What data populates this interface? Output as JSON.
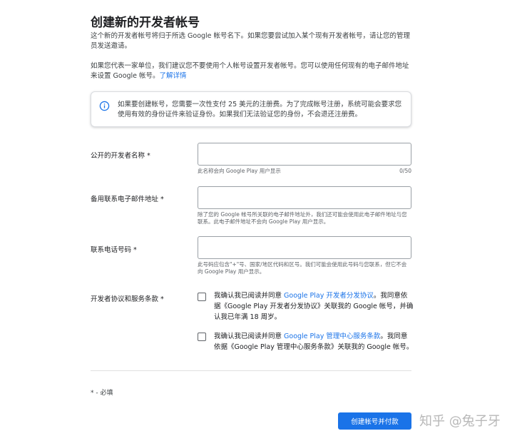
{
  "header": {
    "title": "创建新的开发者帐号"
  },
  "intro": {
    "paragraph1": "这个新的开发者帐号将归于所选 Google 帐号名下。如果您要尝试加入某个现有开发者帐号，请让您的管理员发送邀请。",
    "paragraph2": "如果您代表一家单位，我们建议您不要使用个人帐号设置开发者帐号。您可以使用任何现有的电子邮件地址来设置 Google 帐号。",
    "learn_more": "了解详情"
  },
  "info_card": {
    "icon": "info-icon",
    "text": "如果要创建帐号，您需要一次性支付 25 美元的注册费。为了完成帐号注册，系统可能会要求您使用有效的身份证件来验证身份。如果我们无法验证您的身份，不会退还注册费。"
  },
  "fields": {
    "developer_name": {
      "label": "公开的开发者名称 *",
      "value": "",
      "helper": "此名称会向 Google Play 用户显示",
      "counter": "0/50"
    },
    "backup_email": {
      "label": "备用联系电子邮件地址 *",
      "value": "",
      "helper": "除了您的 Google 帐号所关联的电子邮件地址外，我们还可能会使用此电子邮件地址与您联系。此电子邮件地址不会向 Google Play 用户显示。"
    },
    "phone": {
      "label": "联系电话号码 *",
      "value": "",
      "helper": "此号码应包含\"+\"号、国家/地区代码和区号。我们可能会使用此号码与您联系，但它不会向 Google Play 用户显示。"
    }
  },
  "agreements": {
    "label": "开发者协议和服务条款 *",
    "item1": {
      "checked": false,
      "prefix": "我确认我已阅读并同意 ",
      "link": "Google Play 开发者分发协议",
      "suffix": "。我同意依据《Google Play 开发者分发协议》关联我的 Google 帐号，并确认我已年满 18 周岁。"
    },
    "item2": {
      "checked": false,
      "prefix": "我确认我已阅读并同意 ",
      "link": "Google Play 管理中心服务条款",
      "suffix": "。我同意依据《Google Play 管理中心服务条款》关联我的 Google 帐号。"
    }
  },
  "footer": {
    "required_note": "* - 必填",
    "submit_label": "创建帐号并付款",
    "watermark": "知乎 @兔子牙"
  },
  "colors": {
    "accent": "#1a73e8",
    "text": "#202124",
    "secondary_text": "#5f6368",
    "border": "#dadce0"
  }
}
